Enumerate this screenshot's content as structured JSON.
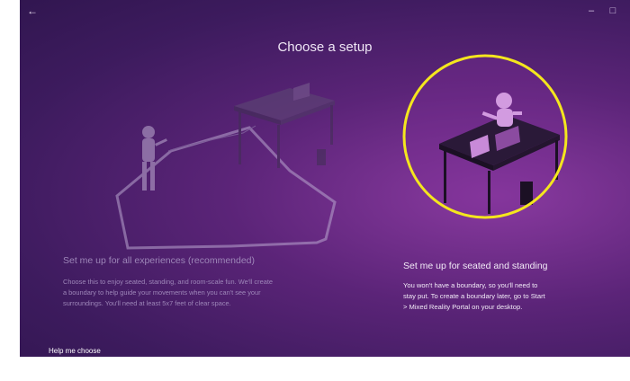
{
  "window": {
    "back_icon": "back-arrow-icon",
    "minimize_icon": "minimize-icon",
    "maximize_icon": "maximize-icon"
  },
  "page": {
    "title": "Choose a setup"
  },
  "options": {
    "all_experiences": {
      "title": "Set me up for all experiences (recommended)",
      "description_lines": [
        "Choose this to enjoy seated, standing, and room-scale fun. We'll create",
        "a boundary to help guide your movements when you can't see your",
        "surroundings. You'll need at least 5x7 feet of clear space."
      ]
    },
    "seated_standing": {
      "title": "Set me up for seated and standing",
      "description_lines": [
        "You won't have a boundary, so you'll need to",
        "stay put. To create a boundary later, go to Start",
        "> Mixed Reality Portal on your desktop."
      ]
    }
  },
  "help_link": {
    "label": "Help me choose"
  },
  "colors": {
    "background": "#4a1f6a",
    "highlight_circle": "#f4e61e",
    "accent_text": "#f2eaf7"
  }
}
